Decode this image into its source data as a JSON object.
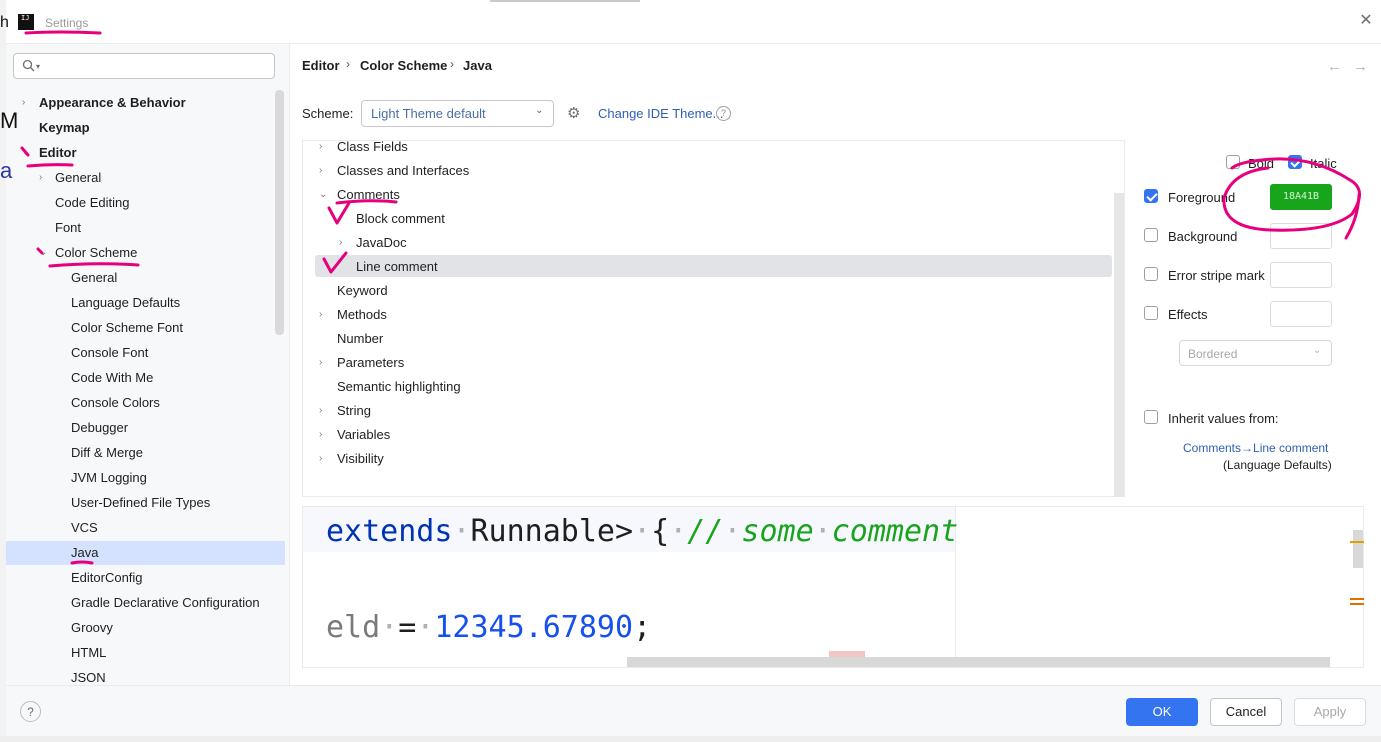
{
  "window": {
    "title": "Settings",
    "logo_text": "IJ"
  },
  "search": {
    "placeholder": ""
  },
  "sidebar": {
    "items": [
      {
        "label": "Appearance & Behavior"
      },
      {
        "label": "Keymap"
      },
      {
        "label": "Editor"
      },
      {
        "label": "General"
      },
      {
        "label": "Code Editing"
      },
      {
        "label": "Font"
      },
      {
        "label": "Color Scheme"
      },
      {
        "label": "General"
      },
      {
        "label": "Language Defaults"
      },
      {
        "label": "Color Scheme Font"
      },
      {
        "label": "Console Font"
      },
      {
        "label": "Code With Me"
      },
      {
        "label": "Console Colors"
      },
      {
        "label": "Debugger"
      },
      {
        "label": "Diff & Merge"
      },
      {
        "label": "JVM Logging"
      },
      {
        "label": "User-Defined File Types"
      },
      {
        "label": "VCS"
      },
      {
        "label": "Java"
      },
      {
        "label": "EditorConfig"
      },
      {
        "label": "Gradle Declarative Configuration"
      },
      {
        "label": "Groovy"
      },
      {
        "label": "HTML"
      },
      {
        "label": "JSON"
      }
    ],
    "selected": "Java"
  },
  "breadcrumb": {
    "items": [
      "Editor",
      "Color Scheme",
      "Java"
    ]
  },
  "scheme": {
    "label": "Scheme:",
    "value": "Light Theme default",
    "change_theme_link": "Change IDE Theme..."
  },
  "color_tree": {
    "items": [
      {
        "label": "Class Fields"
      },
      {
        "label": "Classes and Interfaces"
      },
      {
        "label": "Comments"
      },
      {
        "label": "Block comment"
      },
      {
        "label": "JavaDoc"
      },
      {
        "label": "Line comment"
      },
      {
        "label": "Keyword"
      },
      {
        "label": "Methods"
      },
      {
        "label": "Number"
      },
      {
        "label": "Parameters"
      },
      {
        "label": "Semantic highlighting"
      },
      {
        "label": "String"
      },
      {
        "label": "Variables"
      },
      {
        "label": "Visibility"
      }
    ],
    "selected": "Line comment"
  },
  "options": {
    "bold": {
      "label": "Bold",
      "checked": false
    },
    "italic": {
      "label": "Italic",
      "checked": true
    },
    "foreground": {
      "label": "Foreground",
      "checked": true,
      "color": "18A41B"
    },
    "background": {
      "label": "Background",
      "checked": false
    },
    "error_stripe": {
      "label": "Error stripe mark",
      "checked": false
    },
    "effects": {
      "label": "Effects",
      "checked": false
    },
    "effects_type": "Bordered",
    "inherit": {
      "label": "Inherit values from:",
      "checked": false
    },
    "inherit_link": "Comments→Line comment",
    "inherit_source": "(Language Defaults)"
  },
  "preview": {
    "line1": {
      "keyword": "extends",
      "type": "Runnable>",
      "brace": "{",
      "comment_slashes": "//",
      "comment_w1": "some",
      "comment_w2": "comment"
    },
    "line2": {
      "ident": "eld",
      "op": "=",
      "number": "12345.67890",
      "semi": ";"
    }
  },
  "footer": {
    "help": "?",
    "ok": "OK",
    "cancel": "Cancel",
    "apply": "Apply"
  },
  "colors": {
    "accent": "#3574f0",
    "selection": "#d4e2ff",
    "comment_green": "#18a41b",
    "annotation_pink": "#e6007e"
  }
}
